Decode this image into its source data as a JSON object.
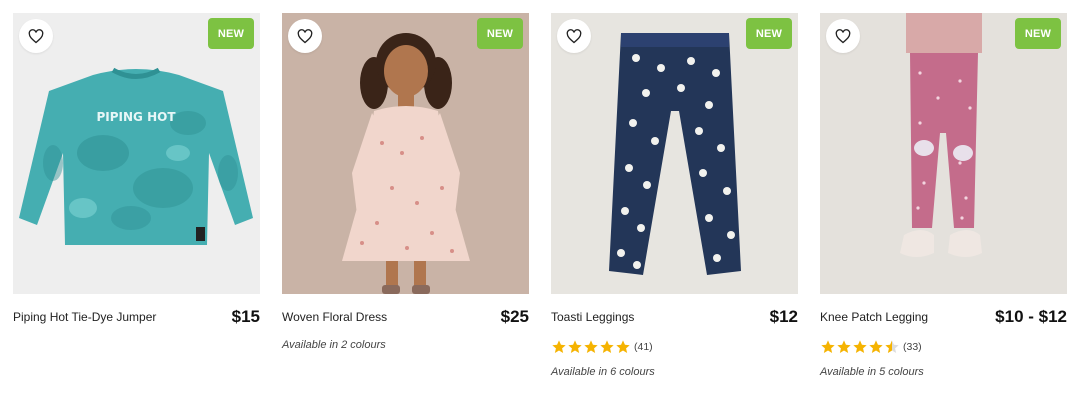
{
  "products": [
    {
      "name": "Piping Hot Tie-Dye Jumper",
      "price": "$15",
      "badge": "NEW",
      "shirt_text": "PIPING HOT"
    },
    {
      "name": "Woven Floral Dress",
      "price": "$25",
      "badge": "NEW",
      "availability": "Available in 2 colours"
    },
    {
      "name": "Toasti Leggings",
      "price": "$12",
      "badge": "NEW",
      "rating_value": 5,
      "rating_count": "(41)",
      "availability": "Available in 6 colours"
    },
    {
      "name": "Knee Patch Legging",
      "price": "$10 - $12",
      "badge": "NEW",
      "rating_value": 4.5,
      "rating_count": "(33)",
      "availability": "Available in 5 colours"
    }
  ],
  "icons": {
    "favourite": "heart-outline-icon",
    "rating": "star-icon"
  },
  "colors": {
    "badge": "#7dc242",
    "star": "#f5b301"
  }
}
